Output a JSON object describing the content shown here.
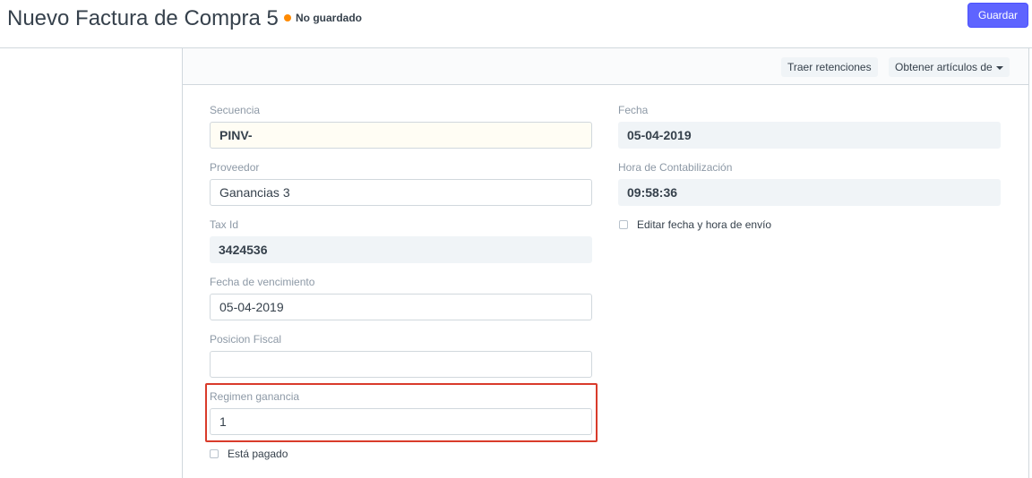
{
  "header": {
    "title": "Nuevo Factura de Compra 5",
    "status": "No guardado",
    "save_button": "Guardar"
  },
  "toolbar": {
    "retenciones_button": "Traer retenciones",
    "obtener_button": "Obtener artículos de"
  },
  "form": {
    "secuencia": {
      "label": "Secuencia",
      "value": "PINV-"
    },
    "proveedor": {
      "label": "Proveedor",
      "value": "Ganancias 3"
    },
    "tax_id": {
      "label": "Tax Id",
      "value": "3424536"
    },
    "fecha_vencimiento": {
      "label": "Fecha de vencimiento",
      "value": "05-04-2019"
    },
    "posicion_fiscal": {
      "label": "Posicion Fiscal",
      "value": ""
    },
    "regimen_ganancia": {
      "label": "Regimen ganancia",
      "value": "1"
    },
    "esta_pagado": {
      "label": "Está pagado",
      "checked": false
    },
    "fecha": {
      "label": "Fecha",
      "value": "05-04-2019"
    },
    "hora_contabilizacion": {
      "label": "Hora de Contabilización",
      "value": "09:58:36"
    },
    "editar_fecha": {
      "label": "Editar fecha y hora de envío",
      "checked": false
    }
  },
  "colors": {
    "primary": "#5e64ff",
    "status_dot": "#ff8a00",
    "highlight_border": "#d93b2b"
  }
}
